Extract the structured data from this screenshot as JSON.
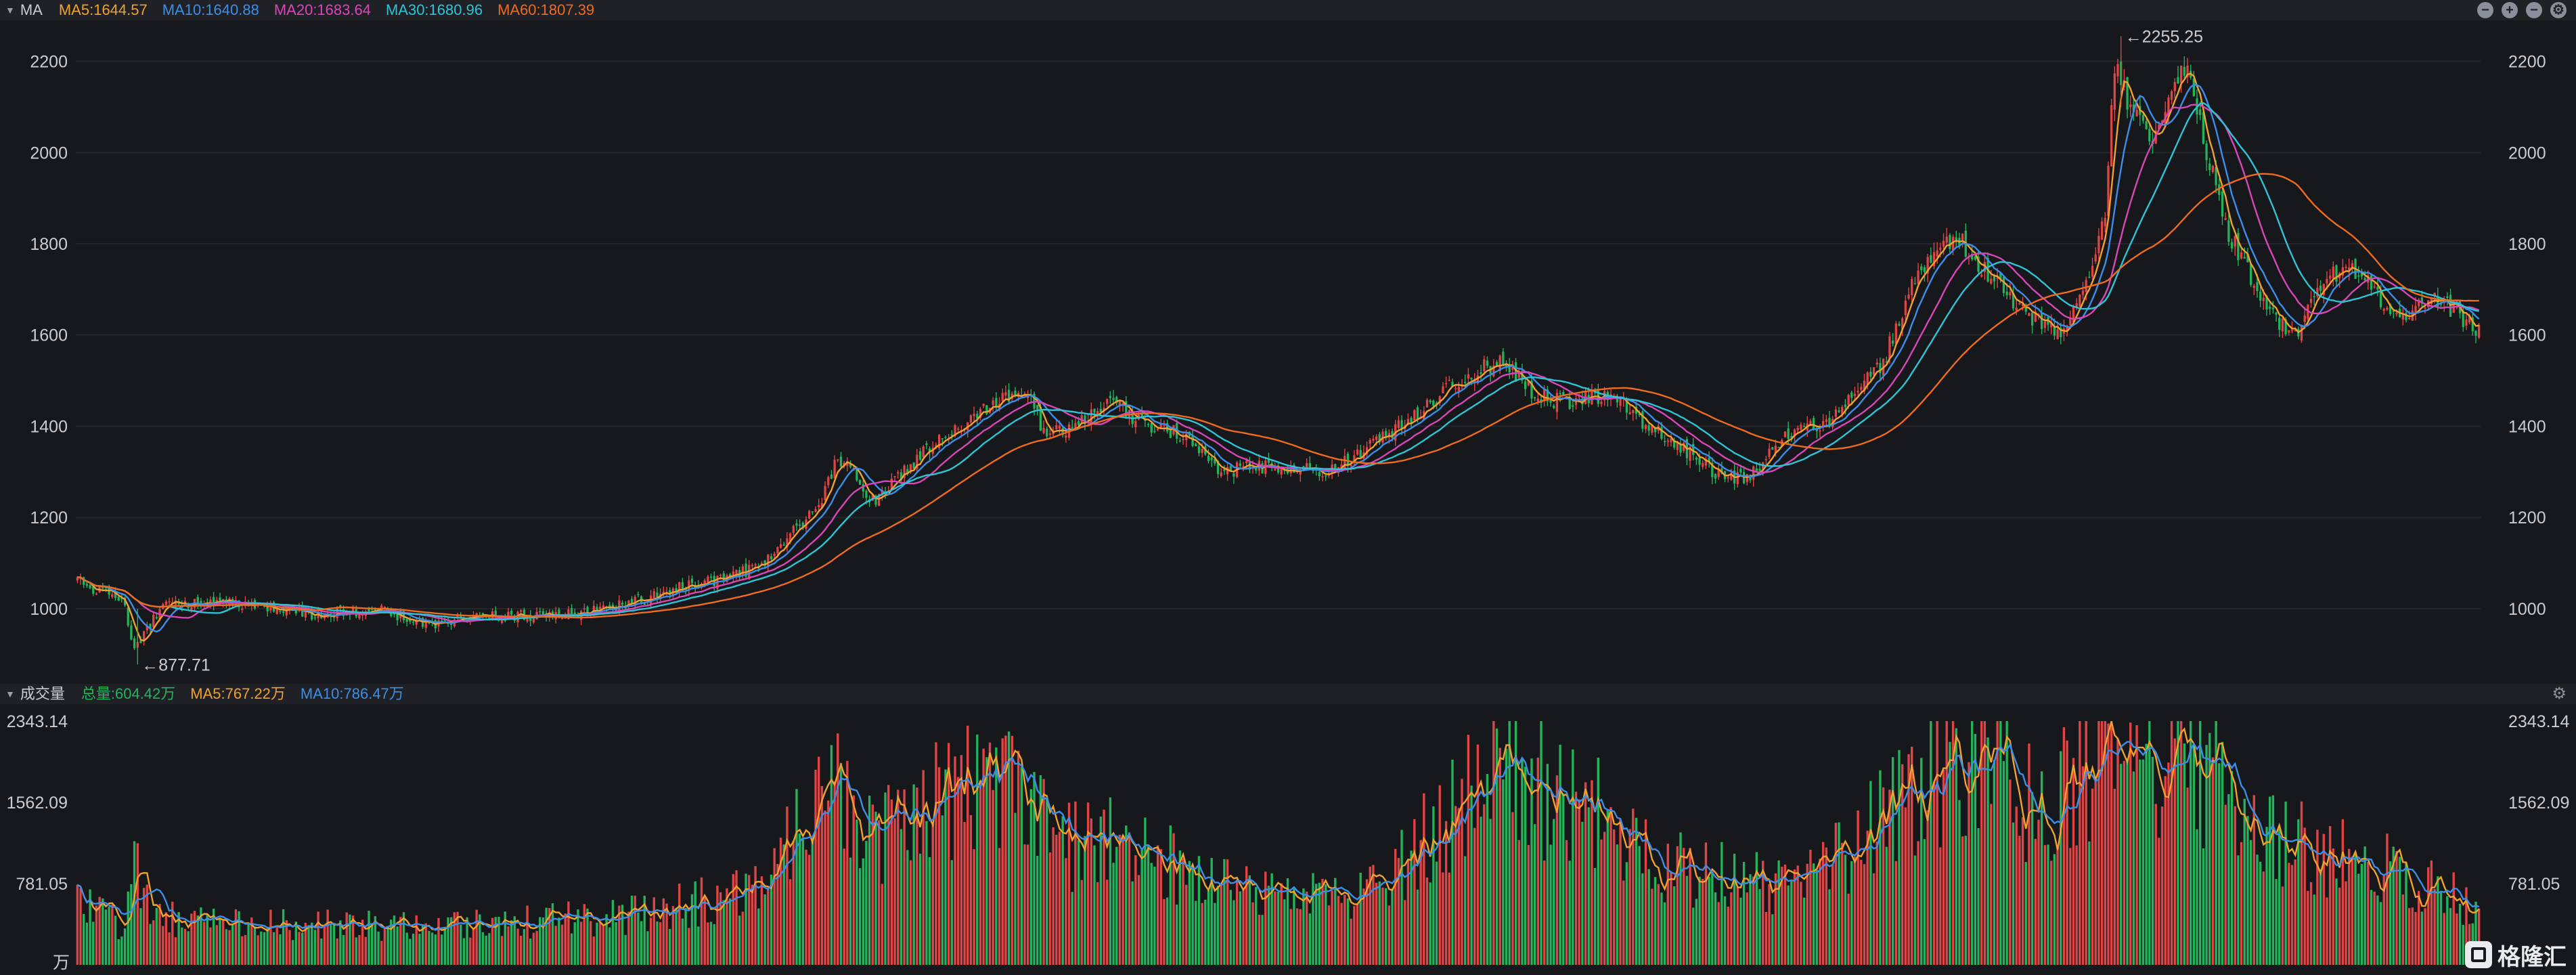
{
  "main_panel": {
    "indicator_label": "MA",
    "ma_legend": [
      {
        "text": "MA5:1644.57",
        "color": "#f0a12f"
      },
      {
        "text": "MA10:1640.88",
        "color": "#3d8ee6"
      },
      {
        "text": "MA20:1683.64",
        "color": "#d946b8"
      },
      {
        "text": "MA30:1680.96",
        "color": "#2ec4d6"
      },
      {
        "text": "MA60:1807.39",
        "color": "#ee6b1f"
      }
    ]
  },
  "volume_panel": {
    "indicator_label": "成交量",
    "legend": [
      {
        "text": "总量:604.42万",
        "color": "#24b35b"
      },
      {
        "text": "MA5:767.22万",
        "color": "#f0a12f"
      },
      {
        "text": "MA10:786.47万",
        "color": "#3d8ee6"
      }
    ],
    "unit": "万"
  },
  "brand": {
    "name": "格隆汇"
  },
  "colors": {
    "up": "#e04545",
    "down": "#24b35b",
    "bg": "#17181c",
    "panel_header": "#202127"
  },
  "chart_data": [
    {
      "type": "candlestick",
      "title": "",
      "y_ticks": [
        1000,
        1200,
        1400,
        1600,
        1800,
        2000,
        2200
      ],
      "ylim": [
        850,
        2275
      ],
      "grid": true,
      "high_marker": {
        "text": "←2255.25",
        "value": 2255.25
      },
      "low_marker": {
        "text": "←877.71",
        "value": 877.71
      },
      "series": [
        {
          "name": "MA5",
          "color": "#f0a12f",
          "window": 5
        },
        {
          "name": "MA10",
          "color": "#3d8ee6",
          "window": 10
        },
        {
          "name": "MA20",
          "color": "#d946b8",
          "window": 20
        },
        {
          "name": "MA30",
          "color": "#2ec4d6",
          "window": 30
        },
        {
          "name": "MA60",
          "color": "#ee6b1f",
          "window": 60
        }
      ],
      "close_path": [
        [
          0,
          1060
        ],
        [
          5,
          1045
        ],
        [
          10,
          1030
        ],
        [
          15,
          1010
        ],
        [
          18,
          905
        ],
        [
          22,
          960
        ],
        [
          28,
          1010
        ],
        [
          40,
          1015
        ],
        [
          60,
          1005
        ],
        [
          75,
          985
        ],
        [
          95,
          1000
        ],
        [
          110,
          965
        ],
        [
          130,
          985
        ],
        [
          150,
          985
        ],
        [
          170,
          1005
        ],
        [
          190,
          1045
        ],
        [
          200,
          1060
        ],
        [
          215,
          1090
        ],
        [
          225,
          1160
        ],
        [
          235,
          1240
        ],
        [
          240,
          1330
        ],
        [
          245,
          1300
        ],
        [
          250,
          1230
        ],
        [
          255,
          1260
        ],
        [
          265,
          1330
        ],
        [
          275,
          1385
        ],
        [
          285,
          1430
        ],
        [
          292,
          1465
        ],
        [
          300,
          1470
        ],
        [
          305,
          1390
        ],
        [
          315,
          1400
        ],
        [
          325,
          1460
        ],
        [
          335,
          1410
        ],
        [
          350,
          1380
        ],
        [
          360,
          1300
        ],
        [
          370,
          1310
        ],
        [
          385,
          1310
        ],
        [
          395,
          1300
        ],
        [
          405,
          1340
        ],
        [
          420,
          1410
        ],
        [
          430,
          1470
        ],
        [
          440,
          1520
        ],
        [
          450,
          1540
        ],
        [
          460,
          1470
        ],
        [
          470,
          1450
        ],
        [
          485,
          1470
        ],
        [
          495,
          1400
        ],
        [
          505,
          1360
        ],
        [
          515,
          1310
        ],
        [
          520,
          1280
        ],
        [
          527,
          1290
        ],
        [
          540,
          1380
        ],
        [
          555,
          1420
        ],
        [
          570,
          1540
        ],
        [
          580,
          1730
        ],
        [
          590,
          1800
        ],
        [
          595,
          1800
        ],
        [
          605,
          1720
        ],
        [
          615,
          1650
        ],
        [
          625,
          1600
        ],
        [
          633,
          1680
        ],
        [
          640,
          1880
        ],
        [
          643,
          2190
        ],
        [
          648,
          2100
        ],
        [
          655,
          2040
        ],
        [
          665,
          2190
        ],
        [
          670,
          2060
        ],
        [
          678,
          1840
        ],
        [
          685,
          1740
        ],
        [
          695,
          1620
        ],
        [
          700,
          1600
        ],
        [
          710,
          1730
        ],
        [
          720,
          1740
        ],
        [
          730,
          1640
        ],
        [
          737,
          1650
        ],
        [
          745,
          1680
        ],
        [
          758,
          1610
        ]
      ],
      "volume_path": [
        [
          0,
          620
        ],
        [
          15,
          420
        ],
        [
          18,
          1000
        ],
        [
          25,
          480
        ],
        [
          60,
          420
        ],
        [
          110,
          390
        ],
        [
          180,
          530
        ],
        [
          215,
          830
        ],
        [
          230,
          1550
        ],
        [
          240,
          2050
        ],
        [
          250,
          1320
        ],
        [
          260,
          1450
        ],
        [
          275,
          1750
        ],
        [
          292,
          2000
        ],
        [
          300,
          1900
        ],
        [
          315,
          1230
        ],
        [
          335,
          1250
        ],
        [
          360,
          800
        ],
        [
          395,
          680
        ],
        [
          410,
          800
        ],
        [
          440,
          1750
        ],
        [
          450,
          2130
        ],
        [
          460,
          1850
        ],
        [
          480,
          1550
        ],
        [
          500,
          1000
        ],
        [
          520,
          950
        ],
        [
          540,
          800
        ],
        [
          560,
          1250
        ],
        [
          575,
          1750
        ],
        [
          590,
          2100
        ],
        [
          600,
          2300
        ],
        [
          620,
          1600
        ],
        [
          640,
          2080
        ],
        [
          648,
          2250
        ],
        [
          665,
          2150
        ],
        [
          690,
          1400
        ],
        [
          710,
          1150
        ],
        [
          740,
          880
        ],
        [
          758,
          600
        ]
      ],
      "n_candles": 759,
      "seed": 424242
    },
    {
      "type": "bar",
      "title": "",
      "y_ticks": [
        "781.05",
        "1562.09",
        "2343.14"
      ],
      "ylim": [
        0,
        2343.14
      ],
      "grid": false
    }
  ]
}
